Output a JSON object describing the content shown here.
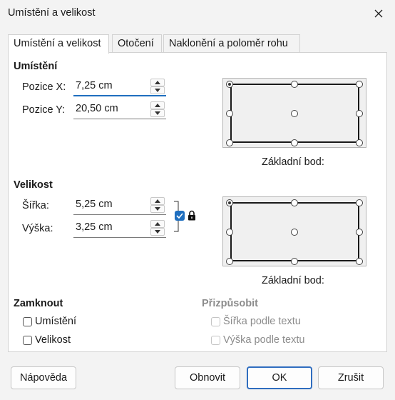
{
  "window": {
    "title": "Umístění a velikost",
    "close_icon": "close-icon"
  },
  "tabs": [
    {
      "label": "Umístění a velikost",
      "active": true
    },
    {
      "label": "Otočení",
      "active": false
    },
    {
      "label": "Naklonění a poloměr rohu",
      "active": false
    }
  ],
  "position": {
    "heading": "Umístění",
    "x_label": "Pozice X:",
    "x_value": "7,25 cm",
    "y_label": "Pozice Y:",
    "y_value": "20,50 cm",
    "base_point_caption": "Základní bod:"
  },
  "size": {
    "heading": "Velikost",
    "width_label": "Šířka:",
    "width_value": "5,25 cm",
    "height_label": "Výška:",
    "height_value": "3,25 cm",
    "keep_ratio_checked": true,
    "lock_icon": "lock-icon",
    "base_point_caption": "Základní bod:"
  },
  "protect": {
    "heading": "Zamknout",
    "position_label": "Umístění",
    "position_checked": false,
    "size_label": "Velikost",
    "size_checked": false
  },
  "adapt": {
    "heading": "Přizpůsobit",
    "fit_width_label": "Šířka podle textu",
    "fit_height_label": "Výška podle textu"
  },
  "buttons": {
    "help": "Nápověda",
    "reset": "Obnovit",
    "ok": "OK",
    "cancel": "Zrušit"
  },
  "colors": {
    "accent": "#1f6fbf",
    "panel_bg": "#ffffff",
    "dialog_bg": "#f3f3f3"
  }
}
